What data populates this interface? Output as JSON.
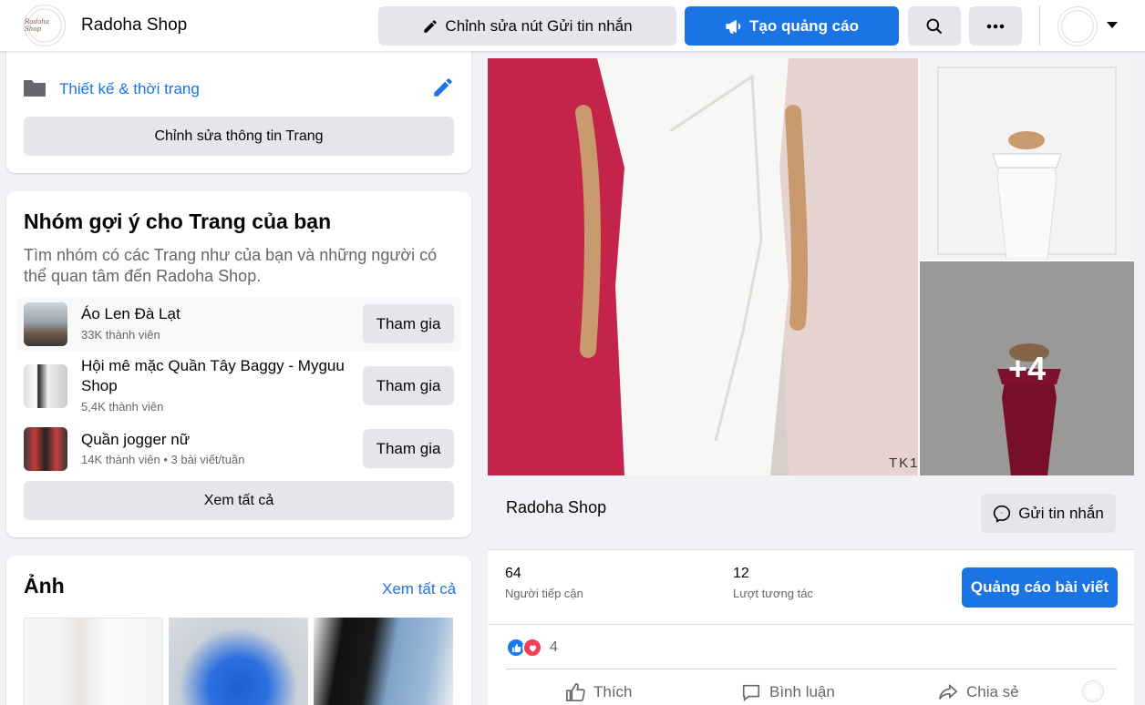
{
  "header": {
    "logo_text": "Radoha Shop",
    "title": "Radoha Shop",
    "edit_message_button": "Chỉnh sửa nút Gửi tin nhắn",
    "create_ad_button": "Tạo quảng cáo",
    "search_icon": "search-icon",
    "more_icon": "more-icon",
    "account_icon": "caret-down-icon"
  },
  "intro": {
    "category": "Thiết kế & thời trang",
    "edit_info_button": "Chỉnh sửa thông tin Trang"
  },
  "suggested_groups": {
    "title": "Nhóm gợi ý cho Trang của bạn",
    "description": "Tìm nhóm có các Trang như của bạn và những người có thể quan tâm đến Radoha Shop.",
    "groups": [
      {
        "name": "Áo Len Đà Lạt",
        "meta": "33K thành viên",
        "join": "Tham gia"
      },
      {
        "name": "Hội mê mặc Quần Tây Baggy - Myguu Shop",
        "meta": "5,4K thành viên",
        "join": "Tham gia"
      },
      {
        "name": "Quần jogger nữ",
        "meta": "14K thành viên • 3 bài viết/tuần",
        "join": "Tham gia"
      }
    ],
    "see_all_button": "Xem tất cả"
  },
  "photos": {
    "title": "Ảnh",
    "see_all": "Xem tất cả"
  },
  "post": {
    "more_photos": "+4",
    "image_label": "TK1",
    "page_name": "Radoha Shop",
    "send_message_button": "Gửi tin nhắn",
    "reach_value": "64",
    "reach_label": "Người tiếp cận",
    "engagement_value": "12",
    "engagement_label": "Lượt tương tác",
    "boost_button": "Quảng cáo bài viết",
    "reaction_count": "4",
    "like_label": "Thích",
    "comment_label": "Bình luận",
    "share_label": "Chia sẻ"
  },
  "colors": {
    "accent": "#1b74e4",
    "background": "#f0f2f5",
    "secondary_text": "#65676b"
  }
}
